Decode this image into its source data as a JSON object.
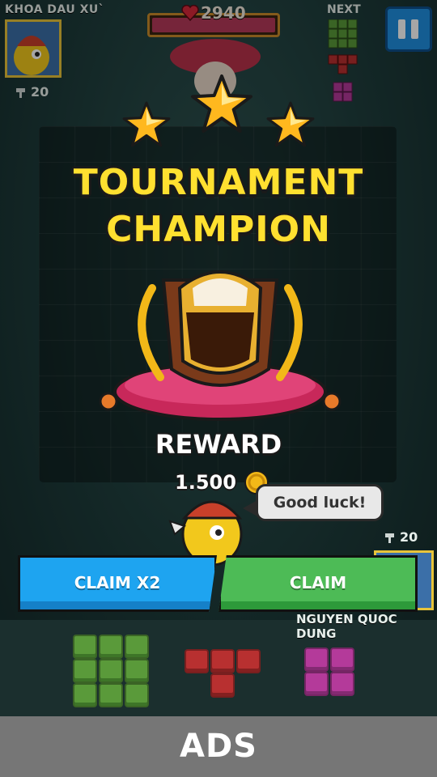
{
  "hud": {
    "player_name": "KHOA DAU XU`",
    "hammer_count": "20",
    "hp_value": "2940",
    "next_label": "NEXT"
  },
  "modal": {
    "title_line1": "TOURNAMENT",
    "title_line2": "CHAMPION",
    "reward_label": "REWARD",
    "reward_amount": "1.500",
    "stars_earned": 3,
    "stars_total": 3
  },
  "opponent": {
    "speech": "Good luck!",
    "hammer_count": "20",
    "name": "NGUYEN QUOC DUNG"
  },
  "buttons": {
    "claim_x2": "CLAIM X2",
    "claim": "CLAIM"
  },
  "footer": {
    "ads_label": "ADS"
  },
  "colors": {
    "title_yellow": "#ffe030",
    "claim_x2_blue": "#1ea4f0",
    "claim_green": "#4dbb56",
    "ads_gray": "#767676"
  }
}
